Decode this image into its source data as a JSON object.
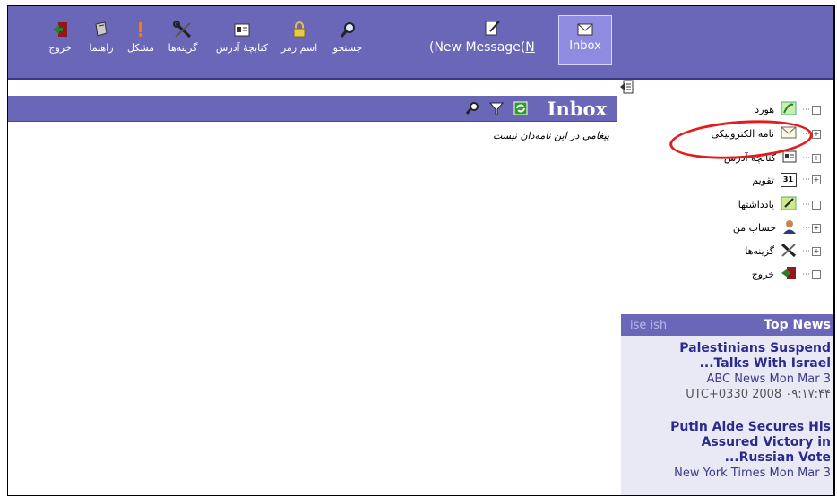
{
  "toolbar": {
    "items": [
      {
        "label": "خروج",
        "icon": "exit-icon"
      },
      {
        "label": "راهنما",
        "icon": "help-book-icon"
      },
      {
        "label": "مشکل",
        "icon": "problem-icon"
      },
      {
        "label": "گزینه‌ها",
        "icon": "options-tools-icon"
      },
      {
        "label": "کتابچهٔ آدرس",
        "icon": "address-book-icon"
      },
      {
        "label": "اسم رمز",
        "icon": "lock-icon"
      },
      {
        "label": "جستجو",
        "icon": "search-icon"
      }
    ],
    "new_message_prefix": "(New Message(",
    "new_message_key": "N",
    "inbox_label": "Inbox"
  },
  "main": {
    "title": "Inbox",
    "empty_message": "پیغامی در این نامه‌دان نیست"
  },
  "sidebar": {
    "items": [
      {
        "label": "هورد",
        "icon": "plant-icon",
        "expand": "☐"
      },
      {
        "label": "نامه الکترونیکی",
        "icon": "envelope-icon",
        "expand": "+"
      },
      {
        "label": "کتابچهٔ آدرس",
        "icon": "address-book-icon",
        "expand": "+"
      },
      {
        "label": "تقویم",
        "icon": "calendar-icon",
        "expand": "+",
        "icon_text": "31"
      },
      {
        "label": "یادداشتها",
        "icon": "note-icon",
        "expand": "☐"
      },
      {
        "label": "حساب من",
        "icon": "user-icon",
        "expand": "+"
      },
      {
        "label": "گزینه‌ها",
        "icon": "options-tools-icon",
        "expand": "+"
      },
      {
        "label": "خروج",
        "icon": "exit-icon",
        "expand": "☐"
      }
    ]
  },
  "news": {
    "header": "Top News",
    "sub": "ise ish",
    "items": [
      {
        "title1": "Palestinians Suspend",
        "title2": "...Talks With Israel",
        "source": "ABC News Mon Mar 3",
        "time": "UTC+0330 2008 ۰۹:۱۷:۴۴"
      },
      {
        "title1": "Putin Aide Secures His",
        "title2": "Assured Victory in",
        "title3": "...Russian Vote",
        "source": "New York Times Mon Mar 3"
      }
    ]
  },
  "colors": {
    "bar": "#6b67b8",
    "highlight": "#e21b1b",
    "news_bg": "#e9e9f6"
  }
}
